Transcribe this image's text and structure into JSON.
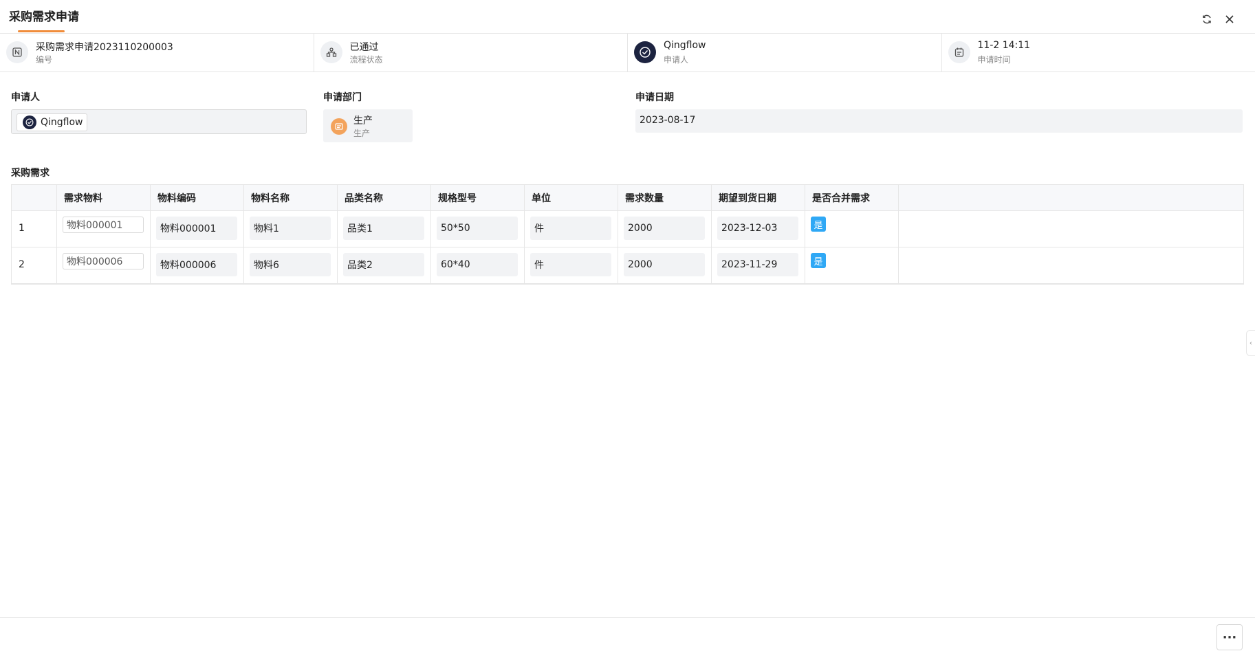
{
  "header": {
    "title": "采购需求申请"
  },
  "summary": [
    {
      "icon": "number-icon",
      "main": "采购需求申请2023110200003",
      "sub": "编号"
    },
    {
      "icon": "workflow-icon",
      "main": "已通过",
      "sub": "流程状态"
    },
    {
      "icon": "user-avatar-icon",
      "main": "Qingflow",
      "sub": "申请人"
    },
    {
      "icon": "calendar-icon",
      "main": "11-2 14:11",
      "sub": "申请时间"
    }
  ],
  "form": {
    "applicant_label": "申请人",
    "applicant_value": "Qingflow",
    "department_label": "申请部门",
    "department_name": "生产",
    "department_sub": "生产",
    "date_label": "申请日期",
    "date_value": "2023-08-17"
  },
  "table": {
    "label": "采购需求",
    "columns": [
      "",
      "需求物料",
      "物料编码",
      "物料名称",
      "品类名称",
      "规格型号",
      "单位",
      "需求数量",
      "期望到货日期",
      "是否合并需求"
    ],
    "rows": [
      {
        "idx": "1",
        "material": "物料000001",
        "code": "物料000001",
        "name": "物料1",
        "category": "品类1",
        "spec": "50*50",
        "unit": "件",
        "qty": "2000",
        "date": "2023-12-03",
        "merge": "是"
      },
      {
        "idx": "2",
        "material": "物料000006",
        "code": "物料000006",
        "name": "物料6",
        "category": "品类2",
        "spec": "60*40",
        "unit": "件",
        "qty": "2000",
        "date": "2023-11-29",
        "merge": "是"
      }
    ]
  },
  "footer": {
    "more_label": "···"
  },
  "colors": {
    "accent": "#f08c3a",
    "badge": "#2fa8f5",
    "dark_avatar": "#1c2340",
    "dept_icon": "#f3a35c"
  }
}
